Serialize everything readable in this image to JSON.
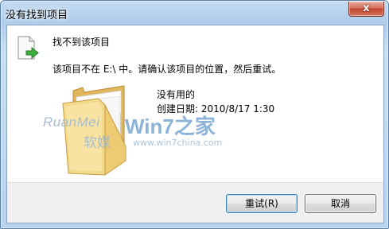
{
  "window": {
    "title": "没有找到项目",
    "close_glyph": "x"
  },
  "dialog": {
    "heading": "找不到该项目",
    "message": "该项目不在 E:\\ 中。请确认该项目的位置，然后重试。",
    "item_name": "没有用的",
    "item_created": "创建日期: 2010/8/17 1:30"
  },
  "watermark": {
    "brand_en": "RuanMei",
    "brand_cn": "软媒",
    "win7": "Win7之家",
    "url": "www.win7china.com"
  },
  "buttons": {
    "retry": "重试(R)",
    "cancel": "取消"
  },
  "icons": {
    "file": "file-moved-icon",
    "folder": "folder-icon"
  },
  "colors": {
    "title_bar": "#aecbea",
    "close_button": "#c0432d",
    "folder": "#f3d98a"
  }
}
